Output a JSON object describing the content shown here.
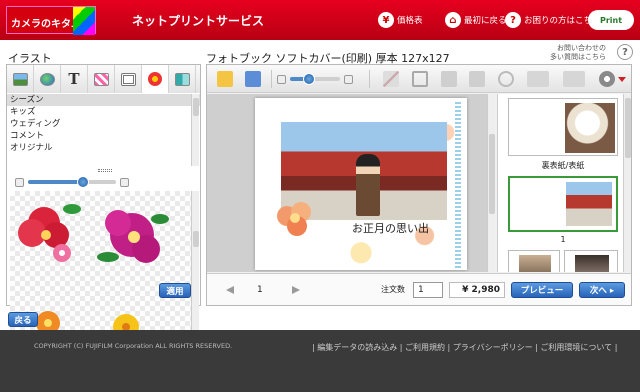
{
  "header": {
    "logo_text": "カメラのキタムラ",
    "service_title": "ネットプリントサービス",
    "nav": [
      {
        "icon": "yen-icon",
        "glyph": "¥",
        "label": "価格表"
      },
      {
        "icon": "home-icon",
        "glyph": "⌂",
        "label": "最初に戻る"
      },
      {
        "icon": "help-icon",
        "glyph": "?",
        "label": "お困りの方はこちら"
      }
    ],
    "print_logo": "Print"
  },
  "left_panel": {
    "title": "イラスト",
    "categories": [
      "シーズン",
      "キッズ",
      "ウェディング",
      "コメント",
      "オリジナル"
    ],
    "zoom_level": 0.62,
    "apply_label": "適用"
  },
  "editor": {
    "title": "フォトブック ソフトカバー(印刷) 厚本 127x127",
    "help_text_1": "お問い合わせの",
    "help_text_2": "多い質問はこちら",
    "help_glyph": "?",
    "zoom_level": 0.38,
    "caption": "お正月の思い出",
    "thumbnails": {
      "cover_label": "裏表紙/表紙",
      "page_label": "1"
    },
    "page_number": "1",
    "qty_label": "注文数",
    "qty_value": "1",
    "price": "¥ 2,980",
    "preview_label": "プレビュー",
    "next_label": "次へ ▸"
  },
  "back_label": "戻る",
  "footer": {
    "copyright": "COPYRIGHT (C) FUJIFILM Corporation ALL RIGHTS RESERVED.",
    "links": "| 編集データの読み込み | ご利用規約 | プライバシーポリシー | ご利用環境について |"
  },
  "colors": {
    "brand_red": "#d7000f",
    "button_blue": "#2863b8",
    "footer_bg": "#3a3a3a"
  }
}
